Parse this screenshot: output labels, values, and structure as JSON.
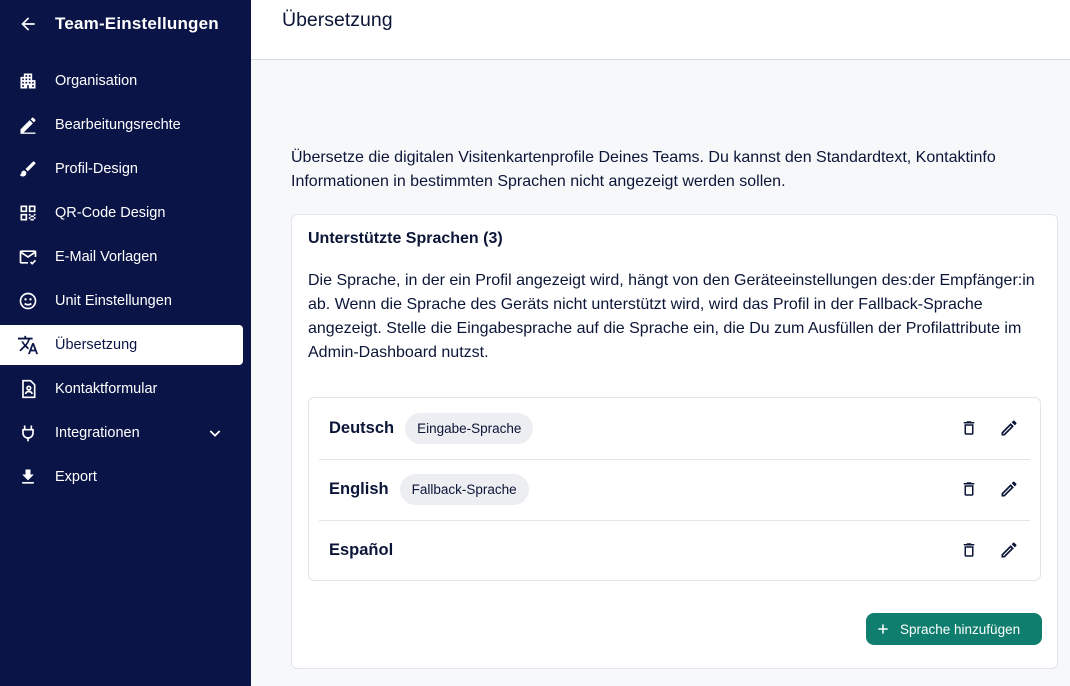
{
  "sidebar": {
    "back_icon": "arrow-left-icon",
    "title": "Team-Einstellungen",
    "items": [
      {
        "label": "Organisation",
        "icon": "building-icon"
      },
      {
        "label": "Bearbeitungsrechte",
        "icon": "edit-pen-icon"
      },
      {
        "label": "Profil-Design",
        "icon": "brush-icon"
      },
      {
        "label": "QR-Code Design",
        "icon": "qr-code-icon"
      },
      {
        "label": "E-Mail Vorlagen",
        "icon": "mail-check-icon"
      },
      {
        "label": "Unit Einstellungen",
        "icon": "face-icon"
      },
      {
        "label": "Übersetzung",
        "icon": "translate-icon",
        "active": true
      },
      {
        "label": "Kontaktformular",
        "icon": "contact-form-icon"
      },
      {
        "label": "Integrationen",
        "icon": "plug-icon",
        "expandable": true
      },
      {
        "label": "Export",
        "icon": "download-icon"
      }
    ]
  },
  "header": {
    "title": "Übersetzung"
  },
  "main": {
    "intro_line1": "Übersetze die digitalen Visitenkartenprofile Deines Teams. Du kannst den Standardtext, Kontaktinfo",
    "intro_line2": "Informationen in bestimmten Sprachen nicht angezeigt werden sollen.",
    "card": {
      "title": "Unterstützte Sprachen (3)",
      "description": "Die Sprache, in der ein Profil angezeigt wird, hängt von den Geräteeinstellungen des:der Empfänger:in ab. Wenn die Sprache des Geräts nicht unterstützt wird, wird das Profil in der Fallback-Sprache angezeigt. Stelle die Eingabesprache auf die Sprache ein, die Du zum Ausfüllen der Profilattribute im Admin-Dashboard nutzst.",
      "languages": [
        {
          "name": "Deutsch",
          "badge": "Eingabe-Sprache"
        },
        {
          "name": "English",
          "badge": "Fallback-Sprache"
        },
        {
          "name": "Español",
          "badge": ""
        }
      ],
      "add_button": "Sprache hinzufügen"
    }
  },
  "colors": {
    "sidebar_bg": "#0a1446",
    "accent": "#0f7e6e",
    "chip_bg": "#eceef2"
  }
}
